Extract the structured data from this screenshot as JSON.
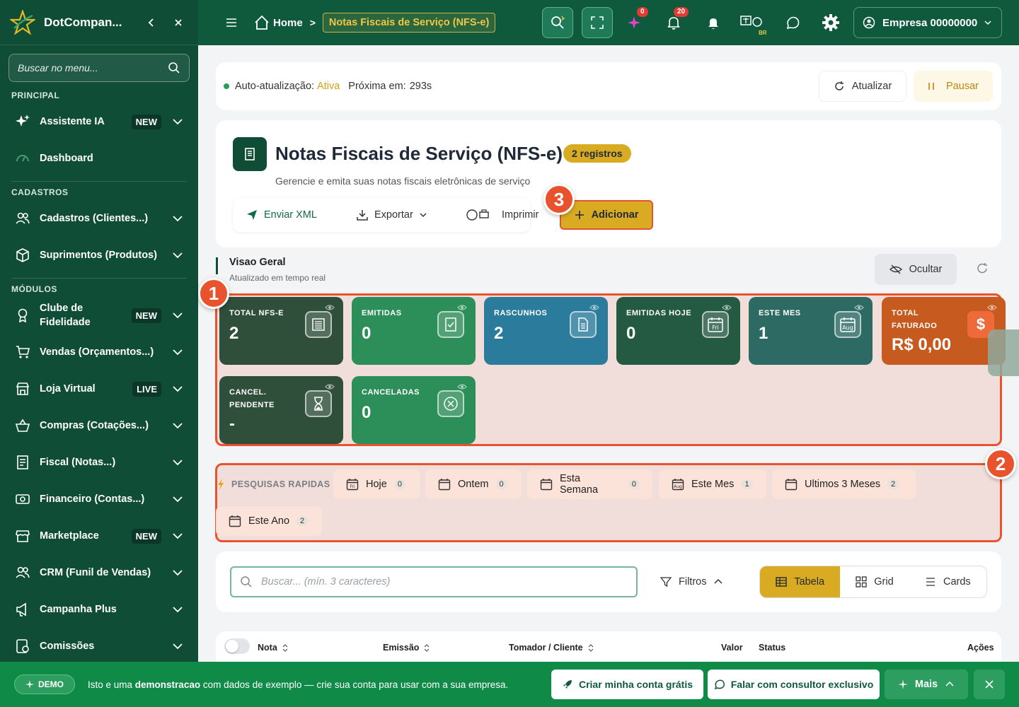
{
  "sidebar": {
    "brand": "DotCompan...",
    "search_placeholder": "Buscar no menu...",
    "sections": {
      "principal": "PRINCIPAL",
      "cadastros": "CADASTROS",
      "modulos": "MÓDULOS"
    },
    "items": [
      {
        "label": "Assistente IA",
        "badge": "NEW"
      },
      {
        "label": "Dashboard",
        "badge": ""
      },
      {
        "label": "Cadastros (Clientes...)",
        "badge": ""
      },
      {
        "label": "Suprimentos (Produtos)",
        "badge": ""
      },
      {
        "label": "Clube de Fidelidade",
        "badge": "NEW"
      },
      {
        "label": "Vendas (Orçamentos...)",
        "badge": ""
      },
      {
        "label": "Loja Virtual",
        "badge": "LIVE"
      },
      {
        "label": "Compras (Cotações...)",
        "badge": ""
      },
      {
        "label": "Fiscal (Notas...)",
        "badge": ""
      },
      {
        "label": "Financeiro (Contas...)",
        "badge": ""
      },
      {
        "label": "Marketplace",
        "badge": "NEW"
      },
      {
        "label": "CRM (Funil de Vendas)",
        "badge": ""
      },
      {
        "label": "Campanha Plus",
        "badge": ""
      },
      {
        "label": "Comissões",
        "badge": ""
      }
    ]
  },
  "topbar": {
    "home": "Home",
    "crumb": "Notas Fiscais de Serviço (NFS-e)",
    "sparkle_count": "0",
    "bell_count": "20",
    "region": "BR",
    "user": "Empresa 00000000"
  },
  "autoupdate": {
    "label": "Auto-atualização:",
    "state": "Ativa",
    "next_label": "Próxima em:",
    "next_value": "293s",
    "refresh": "Atualizar",
    "pause": "Pausar"
  },
  "header": {
    "title": "Notas Fiscais de Serviço (NFS-e)",
    "count": "2 registros",
    "subtitle": "Gerencie e emita suas notas fiscais eletrônicas de serviço",
    "actions": {
      "send_xml": "Enviar XML",
      "export": "Exportar",
      "print": "Imprimir",
      "add": "Adicionar"
    }
  },
  "markers": [
    "1",
    "2",
    "3"
  ],
  "overview": {
    "title": "Visao Geral",
    "subtitle": "Atualizado em tempo real",
    "hide": "Ocultar"
  },
  "stats": [
    {
      "label": "TOTAL NFS-E",
      "value": "2",
      "color": "#2f4f3a",
      "icon": "list-icon"
    },
    {
      "label": "EMITIDAS",
      "value": "0",
      "color": "#2c8e58",
      "icon": "doc-check-icon"
    },
    {
      "label": "RASCUNHOS",
      "value": "2",
      "color": "#2b7c9c",
      "icon": "doc-icon"
    },
    {
      "label": "EMITIDAS HOJE",
      "value": "0",
      "color": "#245a42",
      "icon": "calendar-fri-icon",
      "icon_text": "Fri"
    },
    {
      "label": "ESTE MES",
      "value": "1",
      "color": "#2d6a63",
      "icon": "calendar-aug-icon",
      "icon_text": "Aug"
    },
    {
      "label": "TOTAL FATURADO",
      "value": "R$ 0,00",
      "color": "#c75a1f",
      "icon": "dollar-icon"
    },
    {
      "label": "CANCEL. PENDENTE",
      "value": "-",
      "color": "#2f4f3a",
      "icon": "hourglass-icon"
    },
    {
      "label": "CANCELADAS",
      "value": "0",
      "color": "#2c8e58",
      "icon": "x-circle-icon"
    }
  ],
  "quick_search": {
    "label": "PESQUISAS RAPIDAS",
    "chips": [
      {
        "label": "Hoje",
        "count": "0",
        "icon_text": "Fri"
      },
      {
        "label": "Ontem",
        "count": "0",
        "icon_text": ""
      },
      {
        "label": "Esta Semana",
        "count": "0",
        "icon_text": ""
      },
      {
        "label": "Este Mes",
        "count": "1",
        "icon_text": "Aug"
      },
      {
        "label": "Ultimos 3 Meses",
        "count": "2",
        "icon_text": ""
      },
      {
        "label": "Este Ano",
        "count": "2",
        "icon_text": ""
      }
    ]
  },
  "search": {
    "placeholder": "Buscar... (mín. 3 caracteres)",
    "filters": "Filtros",
    "views": [
      "Tabela",
      "Grid",
      "Cards"
    ]
  },
  "table": {
    "columns": [
      "Nota",
      "Emissão",
      "Tomador / Cliente",
      "Valor",
      "Status",
      "Ações"
    ]
  },
  "demo": {
    "badge": "DEMO",
    "text_pre": "Isto e uma ",
    "text_bold": "demonstracao",
    "text_post": " com dados de exemplo — crie sua conta para usar com a sua empresa.",
    "create": "Criar minha conta grátis",
    "consult": "Falar com consultor exclusivo",
    "more": "Mais"
  },
  "colors": {
    "sidebar": "#0f4d37",
    "topbar": "#0f5a3d",
    "accent": "#d9ab22",
    "highlight": "#e8522c"
  }
}
